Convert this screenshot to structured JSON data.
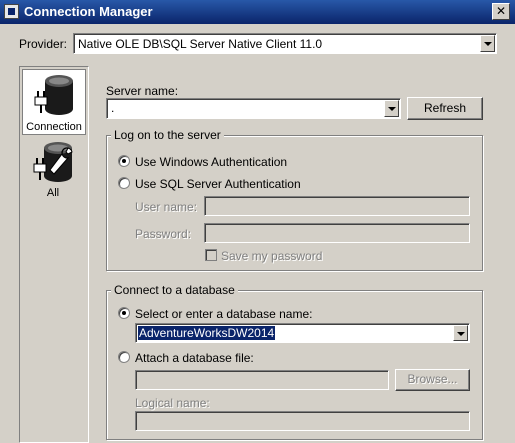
{
  "window": {
    "title": "Connection Manager"
  },
  "provider": {
    "label": "Provider:",
    "value": "Native OLE DB\\SQL Server Native Client 11.0"
  },
  "sidebar": {
    "items": [
      {
        "label": "Connection",
        "icon": "database-plug-icon",
        "selected": true
      },
      {
        "label": "All",
        "icon": "database-wrench-icon",
        "selected": false
      }
    ]
  },
  "server": {
    "label": "Server name:",
    "value": ".",
    "refresh_label": "Refresh"
  },
  "logon": {
    "legend": "Log on to the server",
    "windows_auth_label": "Use Windows Authentication",
    "sql_auth_label": "Use SQL Server Authentication",
    "selected": "windows",
    "username_label": "User name:",
    "username_value": "",
    "password_label": "Password:",
    "password_value": "",
    "save_password_label": "Save my password"
  },
  "database": {
    "legend": "Connect to a database",
    "select_label": "Select or enter a database name:",
    "selected_db": "AdventureWorksDW2014",
    "attach_label": "Attach a database file:",
    "attach_value": "",
    "browse_label": "Browse...",
    "logical_name_label": "Logical name:",
    "logical_name_value": ""
  },
  "colors": {
    "titlebar": "#0a246a",
    "face": "#d4d0c8",
    "selection": "#0a246a"
  }
}
